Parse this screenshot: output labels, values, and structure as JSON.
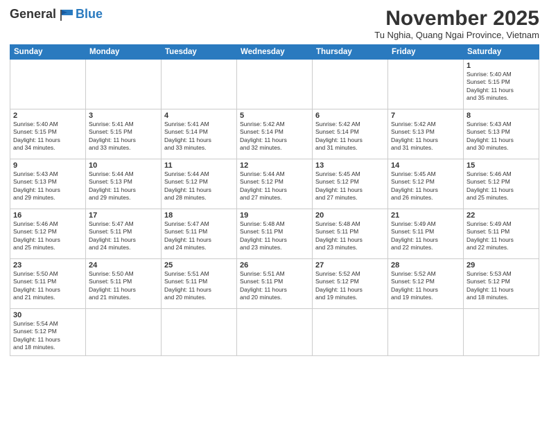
{
  "logo": {
    "general": "General",
    "blue": "Blue"
  },
  "title": "November 2025",
  "subtitle": "Tu Nghia, Quang Ngai Province, Vietnam",
  "days_header": [
    "Sunday",
    "Monday",
    "Tuesday",
    "Wednesday",
    "Thursday",
    "Friday",
    "Saturday"
  ],
  "weeks": [
    [
      {
        "num": "",
        "info": ""
      },
      {
        "num": "",
        "info": ""
      },
      {
        "num": "",
        "info": ""
      },
      {
        "num": "",
        "info": ""
      },
      {
        "num": "",
        "info": ""
      },
      {
        "num": "",
        "info": ""
      },
      {
        "num": "1",
        "info": "Sunrise: 5:40 AM\nSunset: 5:15 PM\nDaylight: 11 hours\nand 35 minutes."
      }
    ],
    [
      {
        "num": "2",
        "info": "Sunrise: 5:40 AM\nSunset: 5:15 PM\nDaylight: 11 hours\nand 34 minutes."
      },
      {
        "num": "3",
        "info": "Sunrise: 5:41 AM\nSunset: 5:15 PM\nDaylight: 11 hours\nand 33 minutes."
      },
      {
        "num": "4",
        "info": "Sunrise: 5:41 AM\nSunset: 5:14 PM\nDaylight: 11 hours\nand 33 minutes."
      },
      {
        "num": "5",
        "info": "Sunrise: 5:42 AM\nSunset: 5:14 PM\nDaylight: 11 hours\nand 32 minutes."
      },
      {
        "num": "6",
        "info": "Sunrise: 5:42 AM\nSunset: 5:14 PM\nDaylight: 11 hours\nand 31 minutes."
      },
      {
        "num": "7",
        "info": "Sunrise: 5:42 AM\nSunset: 5:13 PM\nDaylight: 11 hours\nand 31 minutes."
      },
      {
        "num": "8",
        "info": "Sunrise: 5:43 AM\nSunset: 5:13 PM\nDaylight: 11 hours\nand 30 minutes."
      }
    ],
    [
      {
        "num": "9",
        "info": "Sunrise: 5:43 AM\nSunset: 5:13 PM\nDaylight: 11 hours\nand 29 minutes."
      },
      {
        "num": "10",
        "info": "Sunrise: 5:44 AM\nSunset: 5:13 PM\nDaylight: 11 hours\nand 29 minutes."
      },
      {
        "num": "11",
        "info": "Sunrise: 5:44 AM\nSunset: 5:12 PM\nDaylight: 11 hours\nand 28 minutes."
      },
      {
        "num": "12",
        "info": "Sunrise: 5:44 AM\nSunset: 5:12 PM\nDaylight: 11 hours\nand 27 minutes."
      },
      {
        "num": "13",
        "info": "Sunrise: 5:45 AM\nSunset: 5:12 PM\nDaylight: 11 hours\nand 27 minutes."
      },
      {
        "num": "14",
        "info": "Sunrise: 5:45 AM\nSunset: 5:12 PM\nDaylight: 11 hours\nand 26 minutes."
      },
      {
        "num": "15",
        "info": "Sunrise: 5:46 AM\nSunset: 5:12 PM\nDaylight: 11 hours\nand 25 minutes."
      }
    ],
    [
      {
        "num": "16",
        "info": "Sunrise: 5:46 AM\nSunset: 5:12 PM\nDaylight: 11 hours\nand 25 minutes."
      },
      {
        "num": "17",
        "info": "Sunrise: 5:47 AM\nSunset: 5:11 PM\nDaylight: 11 hours\nand 24 minutes."
      },
      {
        "num": "18",
        "info": "Sunrise: 5:47 AM\nSunset: 5:11 PM\nDaylight: 11 hours\nand 24 minutes."
      },
      {
        "num": "19",
        "info": "Sunrise: 5:48 AM\nSunset: 5:11 PM\nDaylight: 11 hours\nand 23 minutes."
      },
      {
        "num": "20",
        "info": "Sunrise: 5:48 AM\nSunset: 5:11 PM\nDaylight: 11 hours\nand 23 minutes."
      },
      {
        "num": "21",
        "info": "Sunrise: 5:49 AM\nSunset: 5:11 PM\nDaylight: 11 hours\nand 22 minutes."
      },
      {
        "num": "22",
        "info": "Sunrise: 5:49 AM\nSunset: 5:11 PM\nDaylight: 11 hours\nand 22 minutes."
      }
    ],
    [
      {
        "num": "23",
        "info": "Sunrise: 5:50 AM\nSunset: 5:11 PM\nDaylight: 11 hours\nand 21 minutes."
      },
      {
        "num": "24",
        "info": "Sunrise: 5:50 AM\nSunset: 5:11 PM\nDaylight: 11 hours\nand 21 minutes."
      },
      {
        "num": "25",
        "info": "Sunrise: 5:51 AM\nSunset: 5:11 PM\nDaylight: 11 hours\nand 20 minutes."
      },
      {
        "num": "26",
        "info": "Sunrise: 5:51 AM\nSunset: 5:11 PM\nDaylight: 11 hours\nand 20 minutes."
      },
      {
        "num": "27",
        "info": "Sunrise: 5:52 AM\nSunset: 5:12 PM\nDaylight: 11 hours\nand 19 minutes."
      },
      {
        "num": "28",
        "info": "Sunrise: 5:52 AM\nSunset: 5:12 PM\nDaylight: 11 hours\nand 19 minutes."
      },
      {
        "num": "29",
        "info": "Sunrise: 5:53 AM\nSunset: 5:12 PM\nDaylight: 11 hours\nand 18 minutes."
      }
    ],
    [
      {
        "num": "30",
        "info": "Sunrise: 5:54 AM\nSunset: 5:12 PM\nDaylight: 11 hours\nand 18 minutes."
      },
      {
        "num": "",
        "info": ""
      },
      {
        "num": "",
        "info": ""
      },
      {
        "num": "",
        "info": ""
      },
      {
        "num": "",
        "info": ""
      },
      {
        "num": "",
        "info": ""
      },
      {
        "num": "",
        "info": ""
      }
    ]
  ]
}
